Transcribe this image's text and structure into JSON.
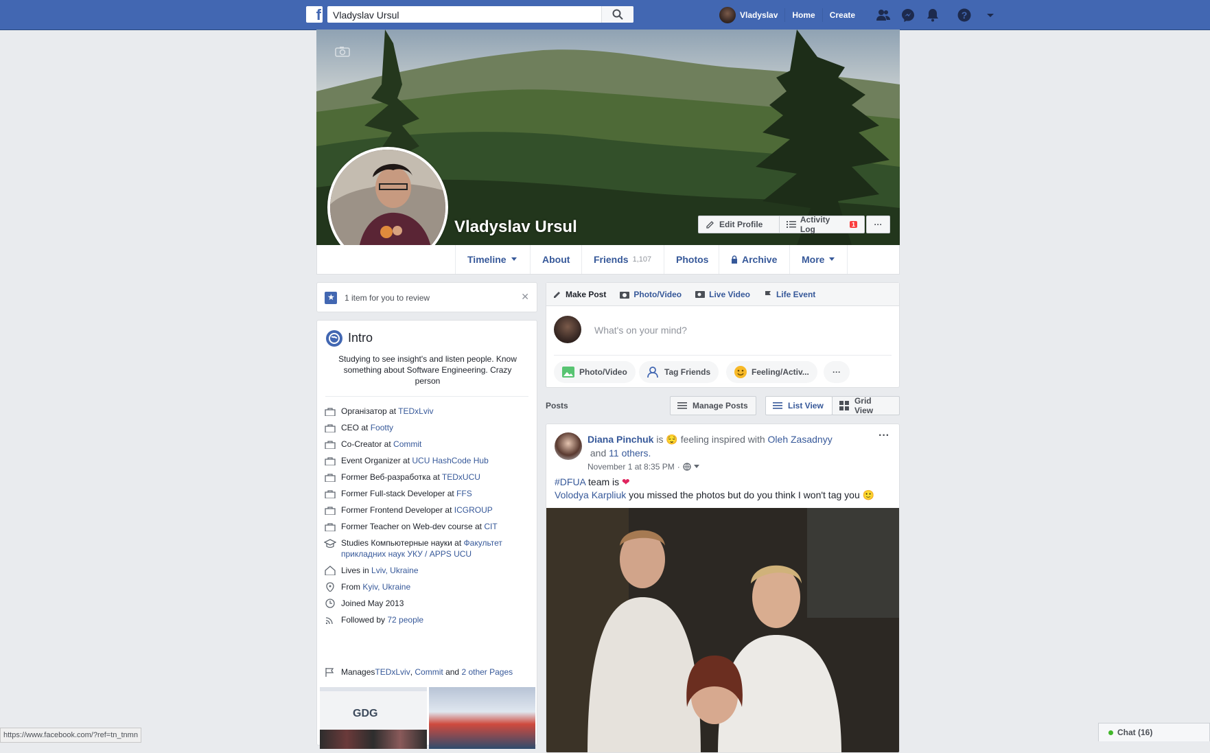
{
  "topbar": {
    "logo": "f",
    "search_value": "Vladyslav Ursul",
    "user_name": "Vladyslav",
    "home": "Home",
    "create": "Create"
  },
  "profile": {
    "name": "Vladyslav Ursul",
    "edit_profile": "Edit Profile",
    "activity_log": "Activity Log",
    "activity_badge": "1",
    "more_dots": "···"
  },
  "tabs": [
    {
      "label": "Timeline"
    },
    {
      "label": "About"
    },
    {
      "label": "Friends",
      "count": "1,107"
    },
    {
      "label": "Photos"
    },
    {
      "label": "Archive"
    },
    {
      "label": "More"
    }
  ],
  "review": {
    "text": "1 item for you to review"
  },
  "intro": {
    "title": "Intro",
    "bio": "Studying to see insight's and listen people. Know something about Software Engineering. Crazy person",
    "items": [
      {
        "icon": "briefcase-icon",
        "pre": "Організатор at ",
        "link": "TEDxLviv",
        "post": ""
      },
      {
        "icon": "briefcase-icon",
        "pre": "CEO at ",
        "link": "Footty",
        "post": ""
      },
      {
        "icon": "briefcase-icon",
        "pre": "Co-Creator at ",
        "link": "Commit",
        "post": ""
      },
      {
        "icon": "briefcase-icon",
        "pre": "Event Organizer at ",
        "link": "UCU HashCode Hub",
        "post": ""
      },
      {
        "icon": "briefcase-icon",
        "pre": "Former Веб-разработка at ",
        "link": "TEDxUCU",
        "post": ""
      },
      {
        "icon": "briefcase-icon",
        "pre": "Former Full-stack Developer at ",
        "link": "FFS",
        "post": ""
      },
      {
        "icon": "briefcase-icon",
        "pre": "Former Frontend Developer at ",
        "link": "ICGROUP",
        "post": ""
      },
      {
        "icon": "briefcase-icon",
        "pre": "Former Teacher on Web-dev course at ",
        "link": "CIT",
        "post": ""
      },
      {
        "icon": "graduation-cap-icon",
        "pre": "Studies Компьютерные науки at ",
        "link": "Факультет прикладних наук УКУ / APPS UCU",
        "post": ""
      },
      {
        "icon": "home-icon",
        "pre": "Lives in ",
        "link": "Lviv, Ukraine",
        "post": ""
      },
      {
        "icon": "location-pin-icon",
        "pre": "From ",
        "link": "Kyiv, Ukraine",
        "post": ""
      },
      {
        "icon": "clock-icon",
        "pre": "Joined May 2013",
        "link": "",
        "post": ""
      },
      {
        "icon": "rss-icon",
        "pre": "Followed by ",
        "link": "72 people",
        "post": ""
      }
    ],
    "manages": {
      "pre": "Manages ",
      "link1": "TEDxLviv",
      "sep": ", ",
      "link2": "Commit",
      "mid": " and ",
      "link3": "2 other Pages"
    },
    "gdg_text": "GDG"
  },
  "composer": {
    "make_post": "Make Post",
    "photo_video": "Photo/Video",
    "live_video": "Live Video",
    "life_event": "Life Event",
    "placeholder": "What's on your mind?",
    "btn_photo": "Photo/Video",
    "btn_tag": "Tag Friends",
    "btn_feeling": "Feeling/Activ...",
    "btn_more": "···"
  },
  "posts_bar": {
    "label": "Posts",
    "manage": "Manage Posts",
    "list_view": "List View",
    "grid_view": "Grid View"
  },
  "post": {
    "author": "Diana Pinchuk",
    "is": " is ",
    "feeling": "feeling inspired with ",
    "with_person": "Oleh Zasadnyy",
    "and": " and ",
    "others": "11 others.",
    "date": "November 1 at 8:35 PM",
    "hashtag": "#DFUA",
    "line1_rest": " team is ",
    "tagged": "Volodya Karpliuk",
    "line2_rest": " you missed the photos but do you think I won't tag you 🙂",
    "more": "···"
  },
  "status_url": "https://www.facebook.com/?ref=tn_tnmn",
  "chat": "Chat (16)",
  "colors": {
    "brand": "#4267b2",
    "link": "#365899",
    "bg": "#e9ebee"
  }
}
